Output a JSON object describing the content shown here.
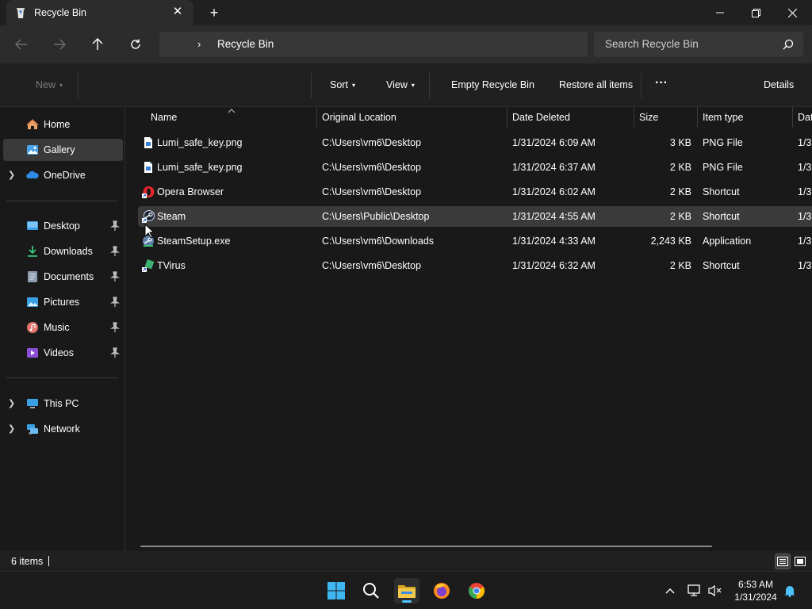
{
  "window": {
    "tab_title": "Recycle Bin"
  },
  "address": {
    "crumb": "Recycle Bin",
    "search_placeholder": "Search Recycle Bin"
  },
  "commands": {
    "new": "New",
    "sort": "Sort",
    "view": "View",
    "empty": "Empty Recycle Bin",
    "restore_all": "Restore all items",
    "more": "···",
    "details": "Details"
  },
  "sidebar": {
    "items": [
      {
        "label": "Home",
        "icon": "home-icon"
      },
      {
        "label": "Gallery",
        "icon": "gallery-icon"
      },
      {
        "label": "OneDrive",
        "icon": "onedrive-icon"
      },
      {
        "label": "Desktop",
        "icon": "desktop-icon"
      },
      {
        "label": "Downloads",
        "icon": "downloads-icon"
      },
      {
        "label": "Documents",
        "icon": "documents-icon"
      },
      {
        "label": "Pictures",
        "icon": "pictures-icon"
      },
      {
        "label": "Music",
        "icon": "music-icon"
      },
      {
        "label": "Videos",
        "icon": "videos-icon"
      },
      {
        "label": "This PC",
        "icon": "this-pc-icon"
      },
      {
        "label": "Network",
        "icon": "network-icon"
      }
    ]
  },
  "columns": [
    "Name",
    "Original Location",
    "Date Deleted",
    "Size",
    "Item type",
    "Dat"
  ],
  "files": [
    {
      "name": "Lumi_safe_key.png",
      "location": "C:\\Users\\vm6\\Desktop",
      "date": "1/31/2024 6:09 AM",
      "size": "3 KB",
      "type": "PNG File",
      "modified": "1/3",
      "icon": "png-file-icon"
    },
    {
      "name": "Lumi_safe_key.png",
      "location": "C:\\Users\\vm6\\Desktop",
      "date": "1/31/2024 6:37 AM",
      "size": "2 KB",
      "type": "PNG File",
      "modified": "1/3",
      "icon": "png-file-icon"
    },
    {
      "name": "Opera Browser",
      "location": "C:\\Users\\vm6\\Desktop",
      "date": "1/31/2024 6:02 AM",
      "size": "2 KB",
      "type": "Shortcut",
      "modified": "1/3",
      "icon": "opera-shortcut-icon"
    },
    {
      "name": "Steam",
      "location": "C:\\Users\\Public\\Desktop",
      "date": "1/31/2024 4:55 AM",
      "size": "2 KB",
      "type": "Shortcut",
      "modified": "1/3",
      "icon": "steam-shortcut-icon"
    },
    {
      "name": "SteamSetup.exe",
      "location": "C:\\Users\\vm6\\Downloads",
      "date": "1/31/2024 4:33 AM",
      "size": "2,243 KB",
      "type": "Application",
      "modified": "1/3",
      "icon": "steam-setup-icon"
    },
    {
      "name": "TVirus",
      "location": "C:\\Users\\vm6\\Desktop",
      "date": "1/31/2024 6:32 AM",
      "size": "2 KB",
      "type": "Shortcut",
      "modified": "1/3",
      "icon": "tvirus-shortcut-icon"
    }
  ],
  "status": {
    "count": "6 items"
  },
  "taskbar": {
    "time": "6:53 AM",
    "date": "1/31/2024"
  },
  "colors": {
    "accent": "#4cc2ff",
    "folder": "#f4c84a"
  }
}
